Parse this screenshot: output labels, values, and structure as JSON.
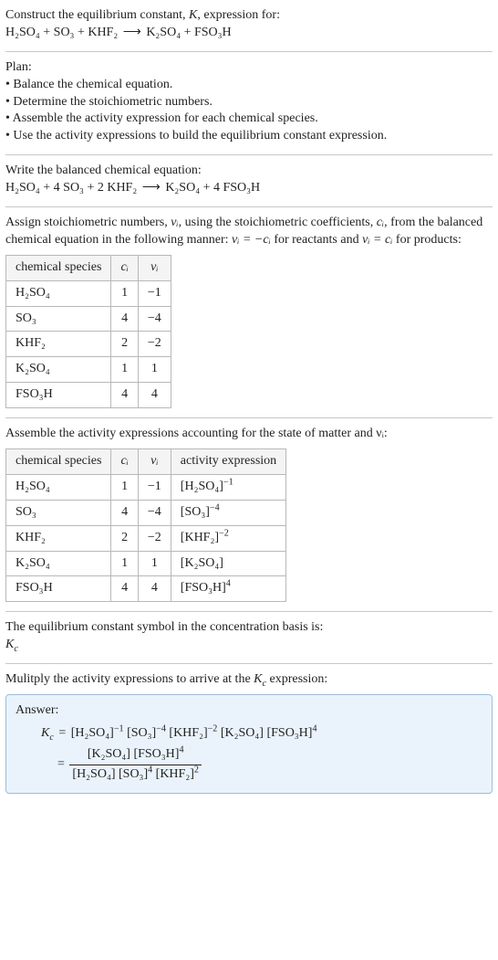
{
  "intro": {
    "line1": "Construct the equilibrium constant, ",
    "K": "K",
    "line1b": ", expression for:",
    "eq_lhs": "H₂SO₄ + SO₃ + KHF₂",
    "arrow": "⟶",
    "eq_rhs": "K₂SO₄ + FSO₃H"
  },
  "plan": {
    "title": "Plan:",
    "items": [
      "• Balance the chemical equation.",
      "• Determine the stoichiometric numbers.",
      "• Assemble the activity expression for each chemical species.",
      "• Use the activity expressions to build the equilibrium constant expression."
    ]
  },
  "balanced": {
    "title": "Write the balanced chemical equation:",
    "eq_lhs": "H₂SO₄ + 4 SO₃ + 2 KHF₂",
    "arrow": "⟶",
    "eq_rhs": "K₂SO₄ + 4 FSO₃H"
  },
  "stoich": {
    "text_a": "Assign stoichiometric numbers, ",
    "nu": "νᵢ",
    "text_b": ", using the stoichiometric coefficients, ",
    "ci": "cᵢ",
    "text_c": ", from the balanced chemical equation in the following manner: ",
    "rel1": "νᵢ = −cᵢ",
    "text_d": " for reactants and ",
    "rel2": "νᵢ = cᵢ",
    "text_e": " for products:"
  },
  "table1": {
    "headers": [
      "chemical species",
      "cᵢ",
      "νᵢ"
    ],
    "rows": [
      {
        "species": "H₂SO₄",
        "c": "1",
        "nu": "−1"
      },
      {
        "species": "SO₃",
        "c": "4",
        "nu": "−4"
      },
      {
        "species": "KHF₂",
        "c": "2",
        "nu": "−2"
      },
      {
        "species": "K₂SO₄",
        "c": "1",
        "nu": "1"
      },
      {
        "species": "FSO₃H",
        "c": "4",
        "nu": "4"
      }
    ]
  },
  "activity_title": "Assemble the activity expressions accounting for the state of matter and νᵢ:",
  "table2": {
    "headers": [
      "chemical species",
      "cᵢ",
      "νᵢ",
      "activity expression"
    ],
    "rows": [
      {
        "species": "H₂SO₄",
        "c": "1",
        "nu": "−1",
        "base": "[H₂SO₄]",
        "exp": "−1"
      },
      {
        "species": "SO₃",
        "c": "4",
        "nu": "−4",
        "base": "[SO₃]",
        "exp": "−4"
      },
      {
        "species": "KHF₂",
        "c": "2",
        "nu": "−2",
        "base": "[KHF₂]",
        "exp": "−2"
      },
      {
        "species": "K₂SO₄",
        "c": "1",
        "nu": "1",
        "base": "[K₂SO₄]",
        "exp": ""
      },
      {
        "species": "FSO₃H",
        "c": "4",
        "nu": "4",
        "base": "[FSO₃H]",
        "exp": "4"
      }
    ]
  },
  "conc_basis": {
    "line1": "The equilibrium constant symbol in the concentration basis is:",
    "Kc": "K",
    "Kc_sub": "c"
  },
  "multiply": {
    "text_a": "Mulitply the activity expressions to arrive at the ",
    "Kc": "K",
    "Kc_sub": "c",
    "text_b": " expression:"
  },
  "answer": {
    "label": "Answer:",
    "Kc": "K",
    "Kc_sub": "c",
    "eq": "=",
    "flat_terms": {
      "t1b": "[H₂SO₄]",
      "t1e": "−1",
      "t2b": "[SO₃]",
      "t2e": "−4",
      "t3b": "[KHF₂]",
      "t3e": "−2",
      "t4b": "[K₂SO₄]",
      "t4e": "",
      "t5b": "[FSO₃H]",
      "t5e": "4"
    },
    "frac": {
      "num": {
        "a": "[K₂SO₄]",
        "bb": "[FSO₃H]",
        "be": "4"
      },
      "den": {
        "a": "[H₂SO₄]",
        "bb": "[SO₃]",
        "be": "4",
        "cb": "[KHF₂]",
        "ce": "2"
      }
    }
  }
}
